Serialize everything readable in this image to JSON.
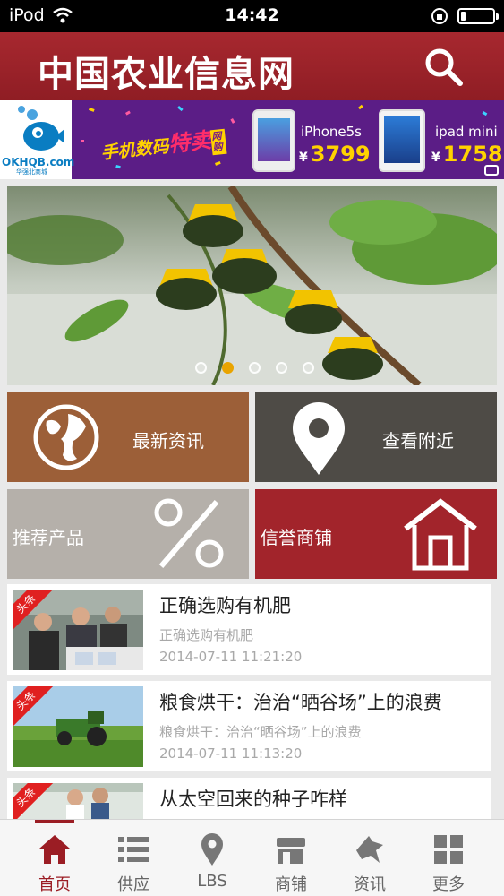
{
  "status_bar": {
    "carrier": "iPod",
    "time": "14:42",
    "battery_level": 0.15
  },
  "header": {
    "title": "中国农业信息网"
  },
  "ad_banner": {
    "brand": "OKHQB.com",
    "brand_sub": "华强北商城",
    "promo_prefix": "手机数码",
    "promo_highlight": "特卖",
    "promo_tag": "网购",
    "items": [
      {
        "name": "iPhone5s",
        "currency": "¥",
        "price": "3799"
      },
      {
        "name": "ipad mini",
        "currency": "¥",
        "price": "1758"
      }
    ]
  },
  "carousel": {
    "slide_count": 5,
    "active_index": 1
  },
  "tiles": [
    {
      "label": "最新资讯",
      "icon": "globe-icon",
      "color": "#9c5f38"
    },
    {
      "label": "查看附近",
      "icon": "location-pin-icon",
      "color": "#4e4b46"
    },
    {
      "label": "推荐产品",
      "icon": "percent-icon",
      "color": "#b5b0aa"
    },
    {
      "label": "信誉商铺",
      "icon": "shop-icon",
      "color": "#a2242b"
    }
  ],
  "news": [
    {
      "badge": "头条",
      "title": "正确选购有机肥",
      "summary": "正确选购有机肥",
      "time": "2014-07-11 11:21:20"
    },
    {
      "badge": "头条",
      "title": "粮食烘干：治治“晒谷场”上的浪费",
      "summary": "粮食烘干：治治“晒谷场”上的浪费",
      "time": "2014-07-11 11:13:20"
    },
    {
      "badge": "头条",
      "title": "从太空回来的种子咋样"
    }
  ],
  "tabbar": {
    "active": "首页",
    "items": [
      {
        "label": "首页",
        "icon": "home-icon"
      },
      {
        "label": "供应",
        "icon": "list-icon"
      },
      {
        "label": "LBS",
        "icon": "map-pin-icon"
      },
      {
        "label": "商铺",
        "icon": "store-icon"
      },
      {
        "label": "资讯",
        "icon": "news-icon"
      },
      {
        "label": "更多",
        "icon": "grid-icon"
      }
    ]
  },
  "colors": {
    "brand": "#9b1d24",
    "header": "#a7282f",
    "accent_dot": "#e9a400"
  }
}
